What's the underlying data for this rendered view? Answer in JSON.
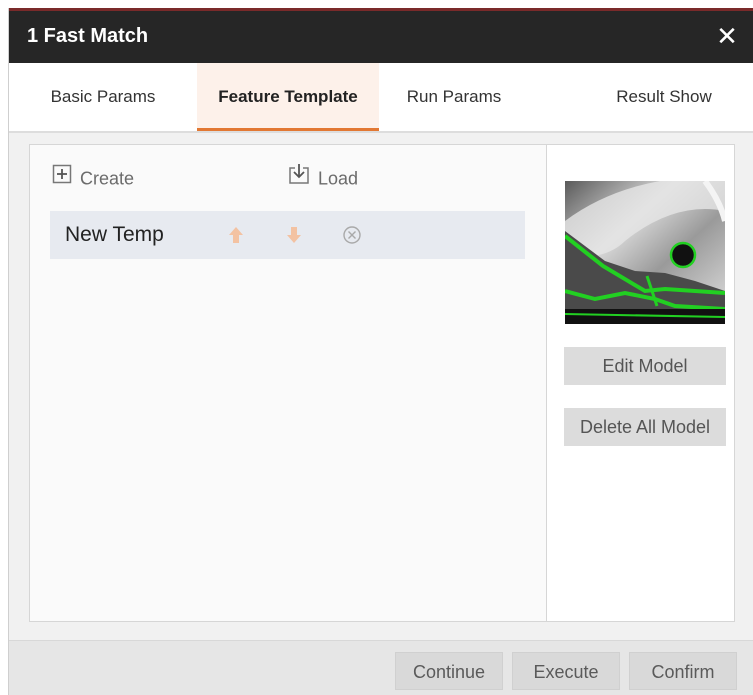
{
  "window": {
    "title": "1 Fast Match",
    "close_glyph": "✕",
    "title_bg": "#262626",
    "accent": "#e27833"
  },
  "tabs": [
    {
      "label": "Basic Params",
      "active": false
    },
    {
      "label": "Feature Template",
      "active": true
    },
    {
      "label": "Run Params",
      "active": false
    },
    {
      "label": "Result Show",
      "active": false
    }
  ],
  "toolbar": {
    "create_label": "Create",
    "create_icon": "plus-box-icon",
    "load_label": "Load",
    "load_icon": "download-box-icon"
  },
  "templates": [
    {
      "name": "New Temp",
      "actions": [
        "arrow-up-icon",
        "arrow-down-icon",
        "delete-circle-icon"
      ]
    }
  ],
  "side": {
    "edit_model_label": "Edit Model",
    "delete_all_label": "Delete All Model",
    "preview": "template-preview-image"
  },
  "footer": {
    "continue_label": "Continue",
    "execute_label": "Execute",
    "confirm_label": "Confirm"
  }
}
